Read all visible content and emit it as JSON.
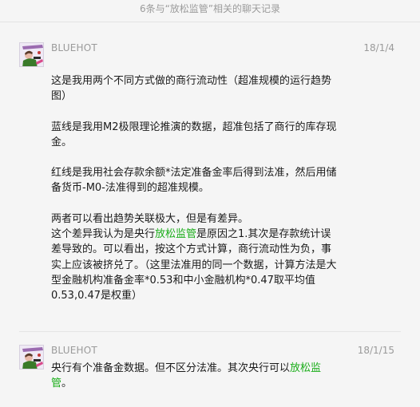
{
  "header": {
    "title": "6条与“放松监管”相关的聊天记录"
  },
  "messages": [
    {
      "sender": "BLUEHOT",
      "date": "18/1/4",
      "paragraphs": [
        [
          "这是我用两个不同方式做的商行流动性（超准规模的运行趋势图）"
        ],
        [
          "蓝线是我用M2极限理论推演的数据，超准包括了商行的库存现金。"
        ],
        [
          "红线是我用社会存款余额*法定准备金率后得到法准，然后用储备货币-M0-法准得到的超准规模。"
        ],
        [
          "两者可以看出趋势关联极大，但是有差异。"
        ],
        [
          "这个差异我认为是央行",
          "放松监管",
          "是原因之1.其次是存款统计误差导致的。可以看出，按这个方式计算，商行流动性为负，事实上应该被挤兑了。（这里法准用的同一个数据，计算方法是大型金融机构准备金率*0.53和中小金融机构*0.47取平均值0.53,0.47是权重）"
        ]
      ]
    },
    {
      "sender": "BLUEHOT",
      "date": "18/1/15",
      "paragraphs": [
        [
          "央行有个准备金数据。但不区分法准。其次央行可以",
          "放松监管",
          "。"
        ]
      ]
    }
  ]
}
